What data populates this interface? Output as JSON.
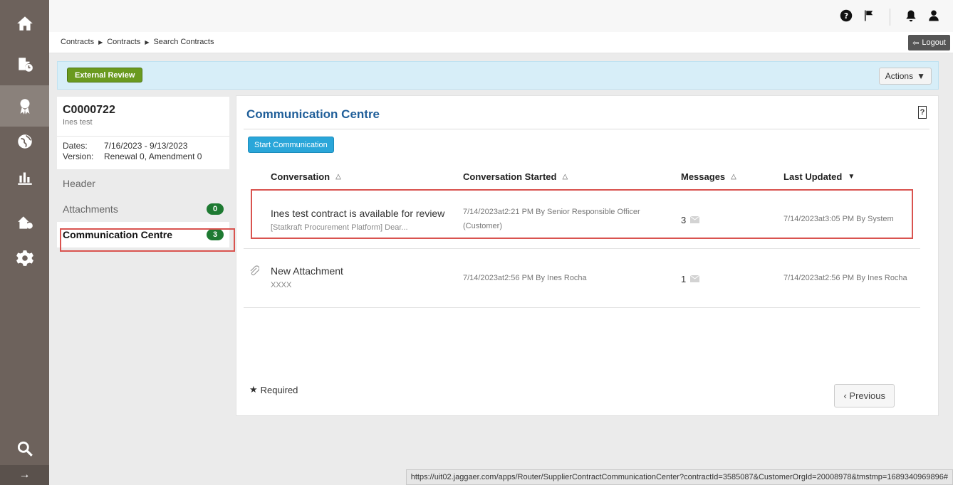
{
  "header": {
    "breadcrumb": [
      "Contracts",
      "Contracts",
      "Search Contracts"
    ],
    "logout_label": "Logout"
  },
  "banner": {
    "status": "External Review",
    "actions_label": "Actions"
  },
  "contract": {
    "id": "C0000722",
    "name": "Ines test",
    "dates_label": "Dates:",
    "dates_value": "7/16/2023 - 9/13/2023",
    "version_label": "Version:",
    "version_value": "Renewal 0, Amendment 0"
  },
  "sidebar_menu": [
    {
      "label": "Header",
      "count": null
    },
    {
      "label": "Attachments",
      "count": "0"
    },
    {
      "label": "Communication Centre",
      "count": "3"
    }
  ],
  "panel": {
    "title": "Communication Centre",
    "help": "?",
    "start_button": "Start Communication",
    "columns": [
      "Conversation",
      "Conversation Started",
      "Messages",
      "Last Updated"
    ]
  },
  "conversations": [
    {
      "subject": "Ines test contract is available for review",
      "snippet": "[Statkraft Procurement Platform] Dear...",
      "started_line1": "7/14/2023at2:21 PM By Senior Responsible Officer",
      "started_line2": "(Customer)",
      "messages": "3",
      "last_updated": "7/14/2023at3:05 PM By System"
    },
    {
      "subject": "New Attachment",
      "snippet": "XXXX",
      "started_line1": "7/14/2023at2:56 PM By Ines Rocha",
      "started_line2": "",
      "messages": "1",
      "last_updated": "7/14/2023at2:56 PM By Ines Rocha"
    }
  ],
  "footer": {
    "required_label": "Required",
    "previous_label": "‹ Previous"
  },
  "status_url": "https://uit02.jaggaer.com/apps/Router/SupplierContractCommunicationCenter?contractId=3585087&CustomerOrgId=20008978&tmstmp=1689340969896#",
  "icons": {
    "nav": [
      "home-icon",
      "contract-clock-icon",
      "award-icon",
      "globe-icon",
      "bar-chart-icon",
      "org-settings-icon",
      "gear-icon",
      "search-icon"
    ],
    "top": [
      "help-icon",
      "flag-icon",
      "bell-icon",
      "user-icon"
    ]
  },
  "colors": {
    "nav_bg": "#6d625c",
    "status_pill": "#6a9a1f",
    "title_blue": "#1f5e99",
    "start_button": "#2aa6d9",
    "count_badge": "#1e7a32",
    "highlight_red": "#d9534f"
  }
}
